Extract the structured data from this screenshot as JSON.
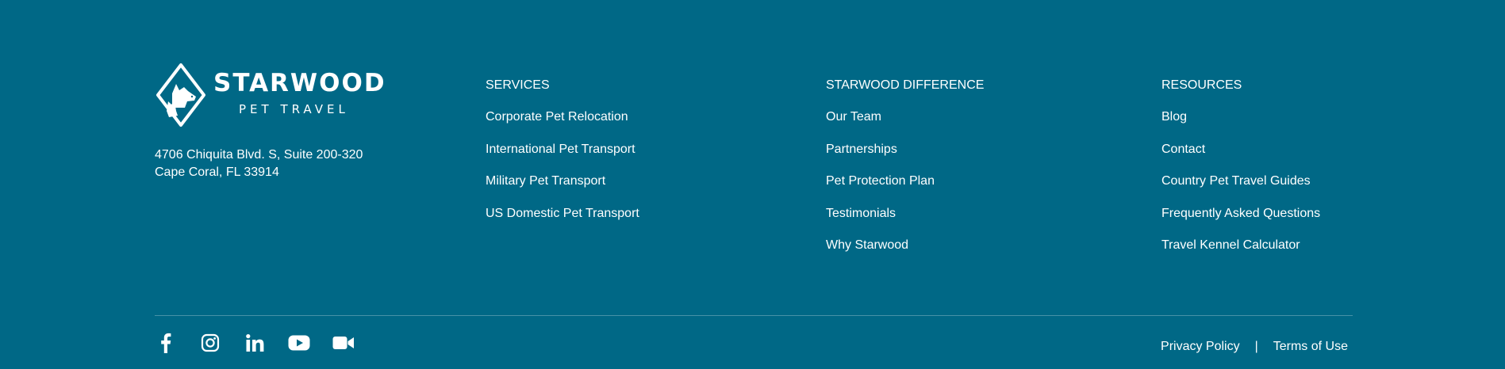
{
  "brand": {
    "name": "STARWOOD",
    "tagline": "PET TRAVEL",
    "logo_icon": "dog-cat-diamond-logo-icon"
  },
  "address": {
    "line1": "4706 Chiquita Blvd. S, Suite 200-320",
    "line2": "Cape Coral, FL 33914"
  },
  "columns": {
    "services": {
      "title": "SERVICES",
      "links": [
        "Corporate Pet Relocation",
        "International Pet Transport",
        "Military Pet Transport",
        "US Domestic Pet Transport"
      ]
    },
    "difference": {
      "title": "STARWOOD DIFFERENCE",
      "links": [
        "Our Team",
        "Partnerships",
        "Pet Protection Plan",
        "Testimonials",
        "Why Starwood"
      ]
    },
    "resources": {
      "title": "RESOURCES",
      "links": [
        "Blog",
        "Contact",
        "Country Pet Travel Guides",
        "Frequently Asked Questions",
        "Travel Kennel Calculator"
      ]
    }
  },
  "social": {
    "icons": [
      "facebook-icon",
      "instagram-icon",
      "linkedin-icon",
      "youtube-icon",
      "video-camera-icon"
    ]
  },
  "legal": {
    "privacy": "Privacy Policy",
    "separator": "|",
    "terms": "Terms of Use"
  },
  "colors": {
    "background": "#006886",
    "text": "#ffffff"
  }
}
